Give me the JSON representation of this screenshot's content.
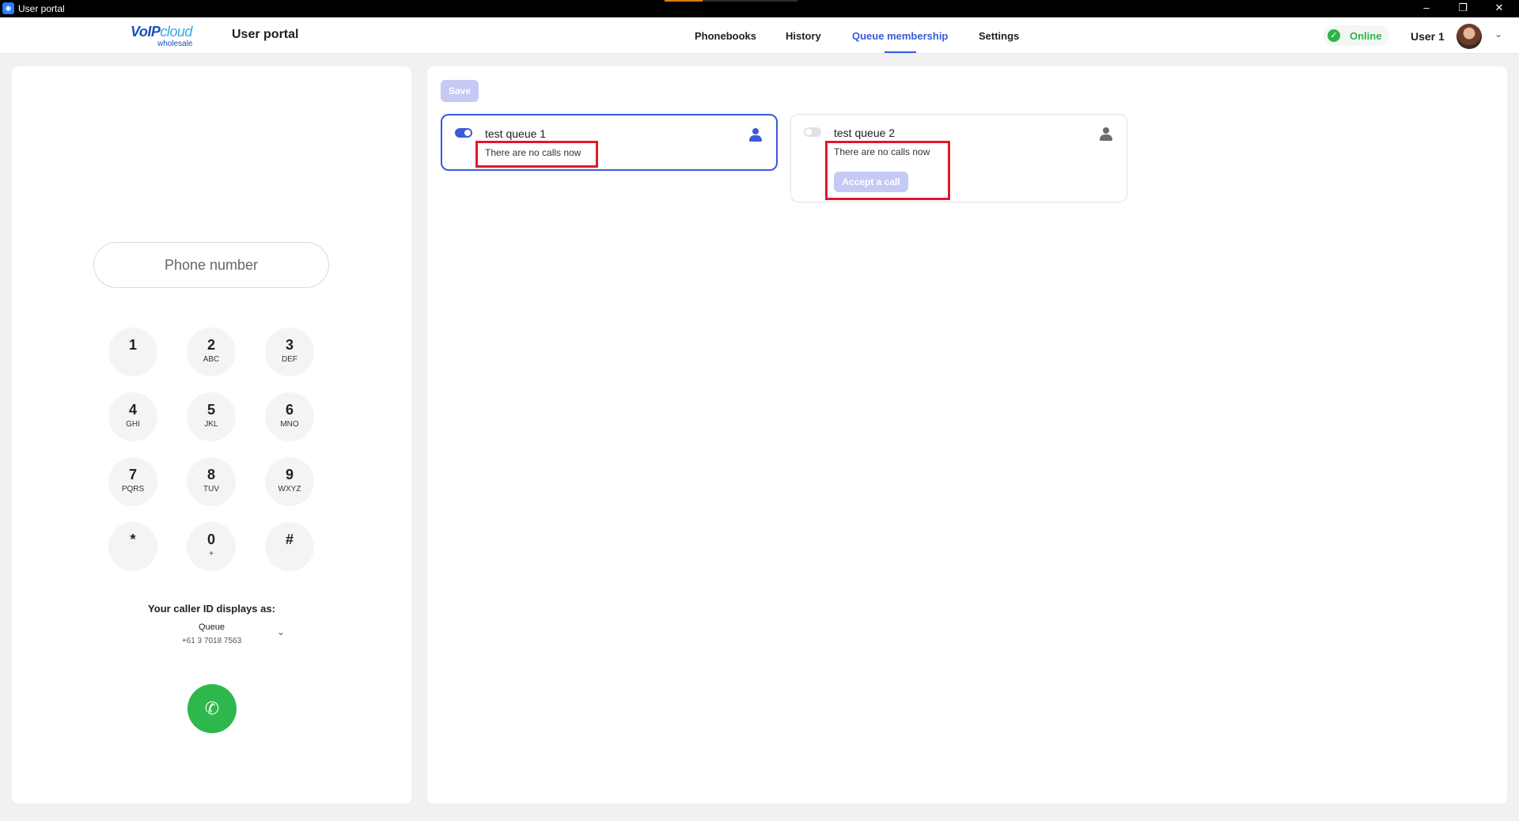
{
  "window": {
    "title": "User portal",
    "controls": {
      "minimize": "–",
      "restore": "❐",
      "close": "✕"
    }
  },
  "header": {
    "logo": {
      "brand_a": "VoIP",
      "brand_b": "cloud",
      "sub": "wholesale"
    },
    "title": "User portal",
    "nav": [
      "Phonebooks",
      "History",
      "Queue membership",
      "Settings"
    ],
    "active_nav": "Queue membership",
    "status": "Online",
    "status_color": "#2fb34a",
    "user_name": "User 1",
    "user_menu_icon": "chevron-down-icon"
  },
  "dialer": {
    "placeholder": "Phone number",
    "keys": [
      {
        "digit": "1",
        "letters": ""
      },
      {
        "digit": "2",
        "letters": "ABC"
      },
      {
        "digit": "3",
        "letters": "DEF"
      },
      {
        "digit": "4",
        "letters": "GHI"
      },
      {
        "digit": "5",
        "letters": "JKL"
      },
      {
        "digit": "6",
        "letters": "MNO"
      },
      {
        "digit": "7",
        "letters": "PQRS"
      },
      {
        "digit": "8",
        "letters": "TUV"
      },
      {
        "digit": "9",
        "letters": "WXYZ"
      },
      {
        "digit": "*",
        "letters": ""
      },
      {
        "digit": "0",
        "letters": "+"
      },
      {
        "digit": "#",
        "letters": ""
      }
    ],
    "caller_id_label": "Your caller ID displays as:",
    "caller_id_name": "Queue",
    "caller_id_number": "+61 3 7018 7563",
    "call_icon": "phone-icon",
    "call_color": "#2db84d"
  },
  "queues": {
    "save_label": "Save",
    "items": [
      {
        "name": "test queue 1",
        "enabled": true,
        "status": "There are no calls now"
      },
      {
        "name": "test queue 2",
        "enabled": false,
        "status": "There are no calls now",
        "action": "Accept a call"
      }
    ],
    "accent": "#3a5bd9",
    "highlight_color": "#e0182d"
  }
}
